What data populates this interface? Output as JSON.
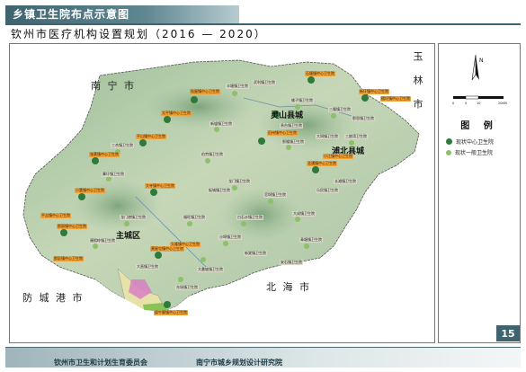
{
  "header": {
    "title": "乡镇卫生院布点示意图"
  },
  "subtitle": "钦州市医疗机构设置规划（2016 — 2020）",
  "map": {
    "neighbors": {
      "nanning": "南 宁 市",
      "yulin": "玉 林 市",
      "beihai": "北 海 市",
      "fangchenggang": "防 城 港 市"
    },
    "cities": {
      "lingshan": "灵山县城",
      "pubei": "浦北县城",
      "qinzhou": "主城区"
    },
    "centers": [
      "陆屋镇中心卫生院",
      "太平镇中心卫生院",
      "旧州镇中心卫生院",
      "石塘镇中心卫生院",
      "新圩镇中心卫生院",
      "檀圩镇中心卫生院",
      "平山镇中心卫生院",
      "张黄镇中心卫生院",
      "小江镇中心卫生院",
      "北通镇中心卫生院",
      "小董镇中心卫生院",
      "大寺镇中心卫生院",
      "那丽镇中心卫生院",
      "黄屋屯镇中心卫生院",
      "犀牛脚镇中心卫生院",
      "平吉镇中心卫生院",
      "那彭镇中心卫生院",
      "久隆镇中心卫生院"
    ],
    "generals": [
      "丰塘镇卫生院",
      "新墟镇卫生院",
      "佛子镇卫生院",
      "三隆镇卫生院",
      "那隆镇卫生院",
      "伯劳镇卫生院",
      "三合镇卫生院",
      "寨圩镇卫生院",
      "龙门镇卫生院",
      "官垌镇卫生院",
      "大成镇卫生院",
      "白石水镇卫生院",
      "福旺镇卫生院",
      "龙门港镇卫生院",
      "康熙岭镇卫生院",
      "大番坡镇卫生院",
      "沙埠镇卫生院",
      "青塘镇卫生院",
      "东场镇卫生院",
      "三娘湾卫生院",
      "贵台镇卫生院",
      "长滩镇卫生院",
      "板城镇卫生院",
      "新棠镇卫生院",
      "大直镇卫生院",
      "那思镇卫生院",
      "大垌镇卫生院",
      "乐民镇卫生院",
      "安石镇卫生院",
      "武利镇卫生院"
    ]
  },
  "legend": {
    "title": "图 例",
    "items": [
      {
        "label": "现状中心卫生院",
        "color": "#2f7a3a"
      },
      {
        "label": "现状一般卫生院",
        "color": "#8cc06a"
      }
    ]
  },
  "scale": {
    "labels": [
      "0",
      "5",
      "10",
      "20KM"
    ]
  },
  "compass": {
    "label": "N"
  },
  "page_number": "15",
  "footer": {
    "left": "钦州市卫生和计划生育委员会",
    "right": "南宁市城乡规划设计研究院"
  }
}
